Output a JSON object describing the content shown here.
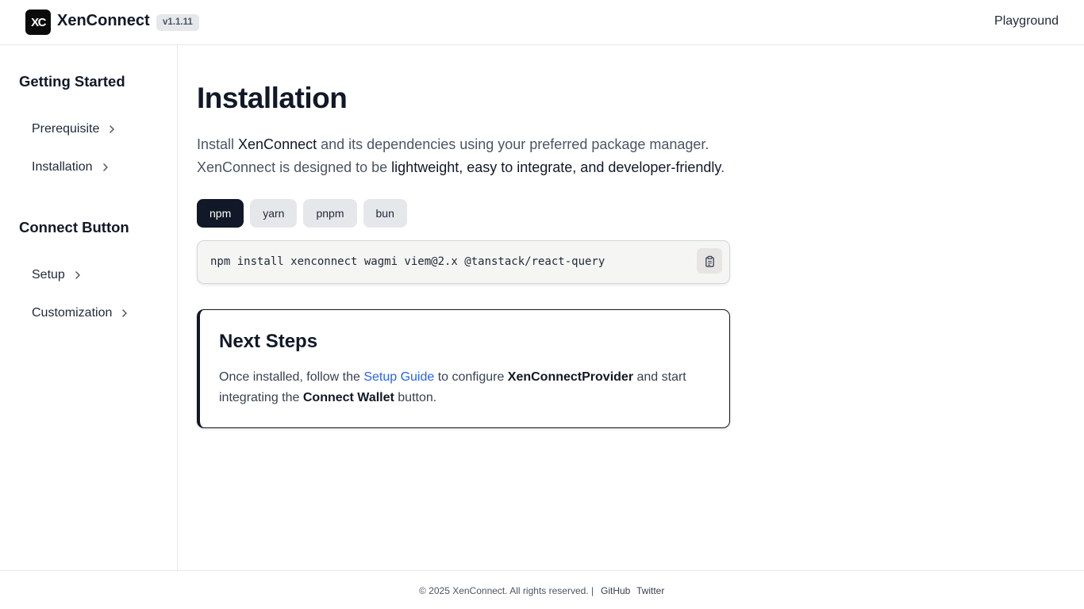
{
  "header": {
    "logo_text": "XC",
    "brand": "XenConnect",
    "version": "v1.1.11",
    "nav_link": "Playground"
  },
  "sidebar": {
    "sections": [
      {
        "title": "Getting Started",
        "items": [
          {
            "label": "Prerequisite"
          },
          {
            "label": "Installation"
          }
        ]
      },
      {
        "title": "Connect Button",
        "items": [
          {
            "label": "Setup"
          },
          {
            "label": "Customization"
          }
        ]
      }
    ]
  },
  "main": {
    "title": "Installation",
    "intro": {
      "p1": "Install ",
      "p1_em": "XenConnect",
      "p2": " and its dependencies using your preferred package manager. XenConnect is designed to be ",
      "p2_em": "lightweight, easy to integrate, and developer-friendly",
      "p3": "."
    },
    "tabs": [
      {
        "label": "npm",
        "active": true
      },
      {
        "label": "yarn"
      },
      {
        "label": "pnpm"
      },
      {
        "label": "bun"
      }
    ],
    "command": "npm install xenconnect wagmi viem@2.x @tanstack/react-query",
    "next_steps": {
      "title": "Next Steps",
      "t1": "Once installed, follow the ",
      "link": "Setup Guide",
      "t2": " to configure ",
      "b1": "XenConnectProvider",
      "t3": " and start integrating the ",
      "b2": "Connect Wallet",
      "t4": " button."
    }
  },
  "footer": {
    "copyright": "© 2025 XenConnect. All rights reserved. |",
    "links": [
      "GitHub",
      "Twitter"
    ]
  },
  "icons": {
    "chevron": "chevron-right-icon",
    "copy": "clipboard-icon"
  }
}
